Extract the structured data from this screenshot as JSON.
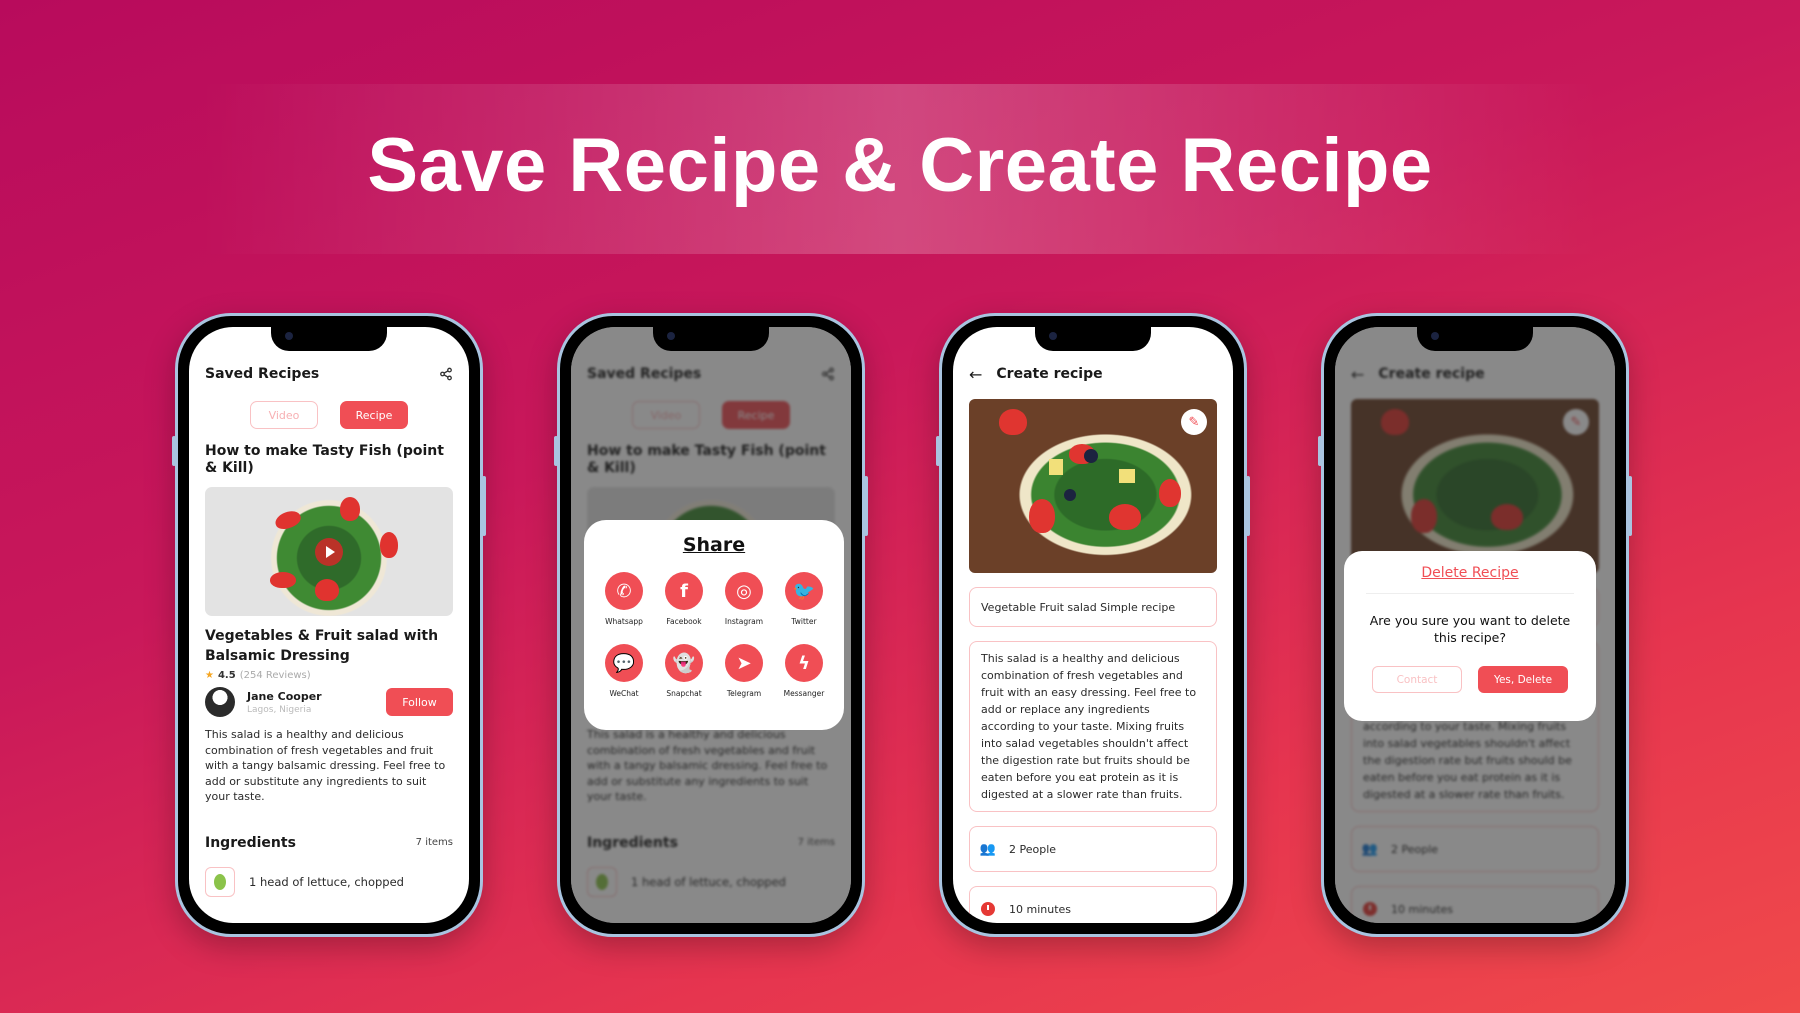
{
  "headline": "Save Recipe & Create Recipe",
  "colors": {
    "accent": "#f04e55",
    "accent_light": "#f9c2c4",
    "bg_start": "#b80b5c",
    "bg_end": "#f04a4a"
  },
  "saved": {
    "title": "Saved Recipes",
    "share_icon": "share-icon",
    "tabs": [
      {
        "label": "Video",
        "active": false
      },
      {
        "label": "Recipe",
        "active": true
      }
    ],
    "recipe_title": "How to make Tasty Fish (point & Kill)",
    "dish_name": "Vegetables & Fruit salad with Balsamic Dressing",
    "rating": "4.5",
    "reviews": "(254 Reviews)",
    "author": {
      "name": "Jane Cooper",
      "location": "Lagos, Nigeria"
    },
    "follow_label": "Follow",
    "description": "This salad is a healthy and delicious combination of fresh vegetables and fruit with a tangy balsamic dressing. Feel free to add or substitute any ingredients to suit your taste.",
    "ingredients_title": "Ingredients",
    "ingredients_count": "7 items",
    "ingredients": [
      {
        "text": "1 head of lettuce, chopped",
        "icon": "lettuce-icon"
      }
    ]
  },
  "share": {
    "title": "Share",
    "items": [
      {
        "label": "Whatsapp",
        "icon": "whatsapp-icon",
        "glyph": "✆"
      },
      {
        "label": "Facebook",
        "icon": "facebook-icon",
        "glyph": "f"
      },
      {
        "label": "Instagram",
        "icon": "instagram-icon",
        "glyph": "◎"
      },
      {
        "label": "Twitter",
        "icon": "twitter-icon",
        "glyph": "🐦"
      },
      {
        "label": "WeChat",
        "icon": "wechat-icon",
        "glyph": "💬"
      },
      {
        "label": "Snapchat",
        "icon": "snapchat-icon",
        "glyph": "👻"
      },
      {
        "label": "Telegram",
        "icon": "telegram-icon",
        "glyph": "➤"
      },
      {
        "label": "Messanger",
        "icon": "messenger-icon",
        "glyph": "ϟ"
      }
    ]
  },
  "create": {
    "title": "Create recipe",
    "back_glyph": "←",
    "edit_glyph": "✎",
    "name_value": "Vegetable Fruit salad Simple recipe",
    "description_value": "This salad is a healthy and delicious combination of fresh vegetables and fruit with an easy dressing. Feel free to add or replace any ingredients according to your taste. Mixing fruits into salad vegetables shouldn't affect the digestion rate but fruits should be eaten before you eat protein as it is digested at a slower rate than fruits.",
    "servings": "2 People",
    "servings_glyph": "👥",
    "time": "10 minutes"
  },
  "delete": {
    "title": "Delete Recipe",
    "question": "Are you sure you want to delete this recipe?",
    "cancel_label": "Contact",
    "confirm_label": "Yes, Delete"
  }
}
